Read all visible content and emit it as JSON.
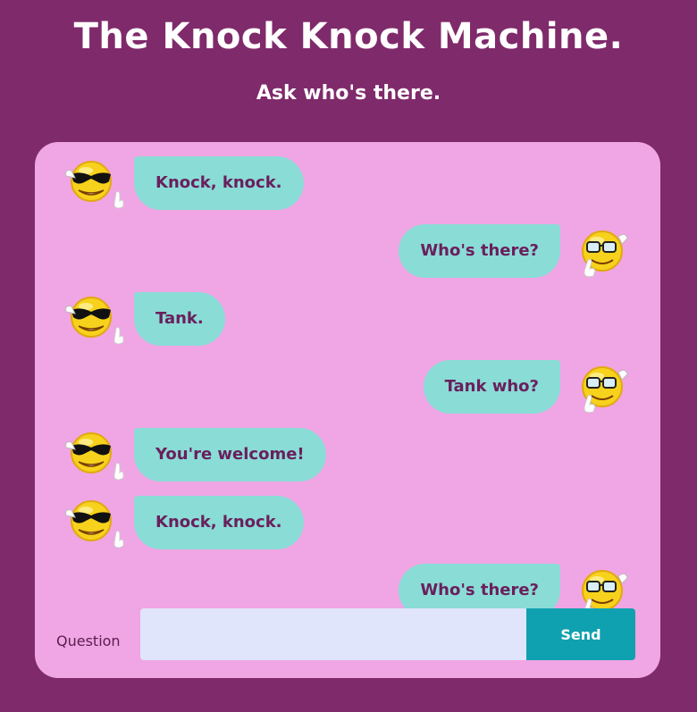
{
  "header": {
    "title": "The Knock Knock Machine.",
    "subtitle": "Ask who's there."
  },
  "messages": [
    {
      "side": "left",
      "text": "Knock, knock.",
      "avatar": "sunglasses-smiley-icon"
    },
    {
      "side": "right",
      "text": "Who's there?",
      "avatar": "glasses-smiley-icon"
    },
    {
      "side": "left",
      "text": "Tank.",
      "avatar": "sunglasses-smiley-icon"
    },
    {
      "side": "right",
      "text": "Tank who?",
      "avatar": "glasses-smiley-icon"
    },
    {
      "side": "left",
      "text": "You're welcome!",
      "avatar": "sunglasses-smiley-icon"
    },
    {
      "side": "left",
      "text": "Knock, knock.",
      "avatar": "sunglasses-smiley-icon"
    },
    {
      "side": "right",
      "text": "Who's there?",
      "avatar": "glasses-smiley-icon"
    }
  ],
  "composer": {
    "label": "Question",
    "input_value": "",
    "send_label": "Send"
  },
  "colors": {
    "background": "#7f2a6b",
    "panel": "#f0a5e4",
    "bubble": "#8adcd6",
    "bubble_text": "#6a1f5c",
    "input": "#e0e5fb",
    "send_button": "#10a1b0"
  }
}
